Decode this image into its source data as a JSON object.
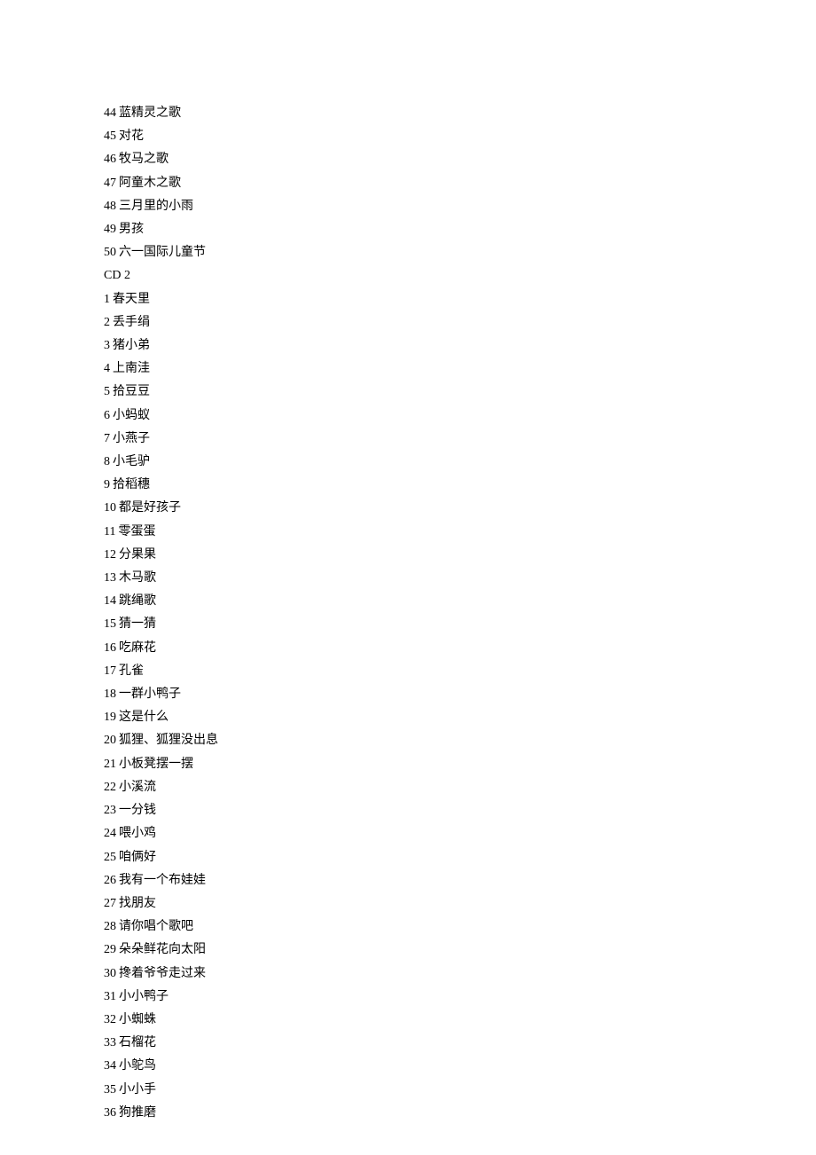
{
  "tracks_cd1_tail": [
    {
      "num": "44",
      "title": "蓝精灵之歌"
    },
    {
      "num": "45",
      "title": "对花"
    },
    {
      "num": "46",
      "title": "牧马之歌"
    },
    {
      "num": "47",
      "title": "阿童木之歌"
    },
    {
      "num": "48",
      "title": "三月里的小雨"
    },
    {
      "num": "49",
      "title": "男孩"
    },
    {
      "num": "50",
      "title": "六一国际儿童节"
    }
  ],
  "cd2_header": "CD 2",
  "tracks_cd2": [
    {
      "num": "1",
      "title": "春天里"
    },
    {
      "num": "2",
      "title": "丢手绢"
    },
    {
      "num": "3",
      "title": "猪小弟"
    },
    {
      "num": "4",
      "title": "上南洼"
    },
    {
      "num": "5",
      "title": "拾豆豆"
    },
    {
      "num": "6",
      "title": "小蚂蚁"
    },
    {
      "num": "7",
      "title": "小燕子"
    },
    {
      "num": "8",
      "title": "小毛驴"
    },
    {
      "num": "9",
      "title": "拾稻穗"
    },
    {
      "num": "10",
      "title": "都是好孩子"
    },
    {
      "num": "11",
      "title": "零蛋蛋"
    },
    {
      "num": "12",
      "title": "分果果"
    },
    {
      "num": "13",
      "title": "木马歌"
    },
    {
      "num": "14",
      "title": "跳绳歌"
    },
    {
      "num": "15",
      "title": "猜一猜"
    },
    {
      "num": "16",
      "title": "吃麻花"
    },
    {
      "num": "17",
      "title": "孔雀"
    },
    {
      "num": "18",
      "title": "一群小鸭子"
    },
    {
      "num": "19",
      "title": "这是什么"
    },
    {
      "num": "20",
      "title": "狐狸、狐狸没出息"
    },
    {
      "num": "21",
      "title": "小板凳摆一摆"
    },
    {
      "num": "22",
      "title": "小溪流"
    },
    {
      "num": "23",
      "title": "一分钱"
    },
    {
      "num": "24",
      "title": "喂小鸡"
    },
    {
      "num": "25",
      "title": "咱俩好"
    },
    {
      "num": "26",
      "title": "我有一个布娃娃"
    },
    {
      "num": "27",
      "title": "找朋友"
    },
    {
      "num": "28",
      "title": "请你唱个歌吧"
    },
    {
      "num": "29",
      "title": "朵朵鲜花向太阳"
    },
    {
      "num": "30",
      "title": "搀着爷爷走过来"
    },
    {
      "num": "31",
      "title": "小小鸭子"
    },
    {
      "num": "32",
      "title": "小蜘蛛"
    },
    {
      "num": "33",
      "title": "石榴花"
    },
    {
      "num": "34",
      "title": "小鸵鸟"
    },
    {
      "num": "35",
      "title": "小小手"
    },
    {
      "num": "36",
      "title": "狗推磨"
    }
  ]
}
